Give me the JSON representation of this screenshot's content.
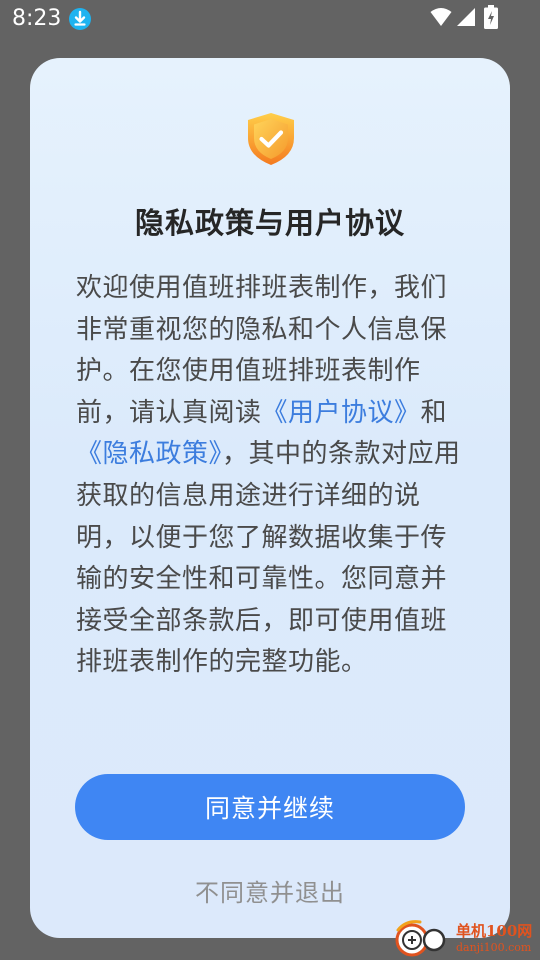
{
  "status_bar": {
    "time": "8:23",
    "icons": [
      "download-notification-icon",
      "wifi-icon",
      "signal-icon",
      "battery-charging-icon"
    ]
  },
  "dialog": {
    "icon": "shield-check-icon",
    "title": "隐私政策与用户协议",
    "body": {
      "part1": "欢迎使用值班排班表制作，我们非常重视您的隐私和个人信息保护。在您使用值班排班表制作前，请认真阅读",
      "user_agreement_link": "《用户协议》",
      "and": "和",
      "privacy_policy_link": "《隐私政策》",
      "part2": "，其中的条款对应用获取的信息用途进行详细的说明，以便于您了解数据收集于传输的安全性和可靠性。您同意并接受全部条款后，即可使用值班排班表制作的完整功能。"
    },
    "agree_label": "同意并继续",
    "disagree_label": "不同意并退出"
  },
  "watermark": {
    "text": "单机100网",
    "url": "danji100.com"
  },
  "colors": {
    "overlay": "#636363",
    "card_top": "#e6f2fd",
    "card_bottom": "#dce9fb",
    "primary_button": "#3f86f3",
    "link": "#3c7dde",
    "shield_orange": "#f5a623"
  }
}
